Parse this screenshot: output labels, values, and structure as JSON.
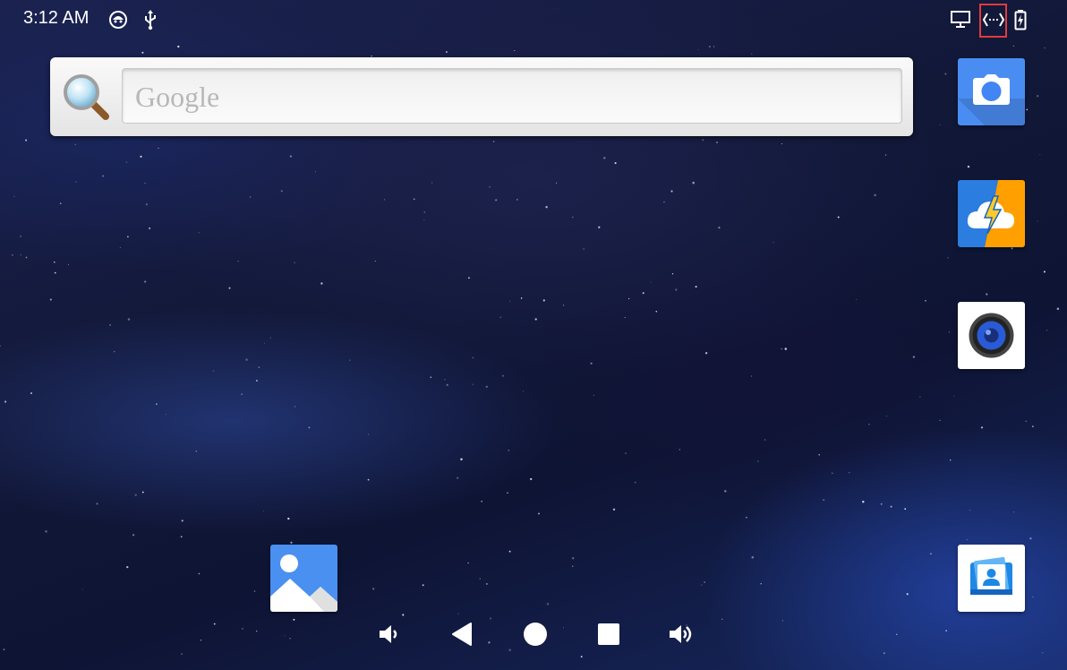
{
  "status_bar": {
    "time": "3:12 AM",
    "left_icons": [
      "android-notification-icon",
      "usb-icon"
    ],
    "right_icons": [
      "monitor-icon",
      "code-brackets-icon",
      "battery-charging-icon"
    ],
    "highlight_color": "#e23b3b"
  },
  "search": {
    "placeholder": "Google"
  },
  "apps": [
    {
      "name": "camera-app",
      "icon": "camera-icon",
      "color": "#4285f4"
    },
    {
      "name": "weather-app",
      "icon": "cloud-lightning-icon",
      "color": "#1e88e5"
    },
    {
      "name": "music-app",
      "icon": "speaker-icon",
      "color": "#ffffff"
    },
    {
      "name": "gallery-app",
      "icon": "image-icon",
      "color": "#4a90f0"
    },
    {
      "name": "contacts-app",
      "icon": "contact-card-icon",
      "color": "#ffffff"
    }
  ],
  "nav_bar": [
    "volume-down-icon",
    "back-icon",
    "home-icon",
    "recents-icon",
    "volume-up-icon"
  ]
}
